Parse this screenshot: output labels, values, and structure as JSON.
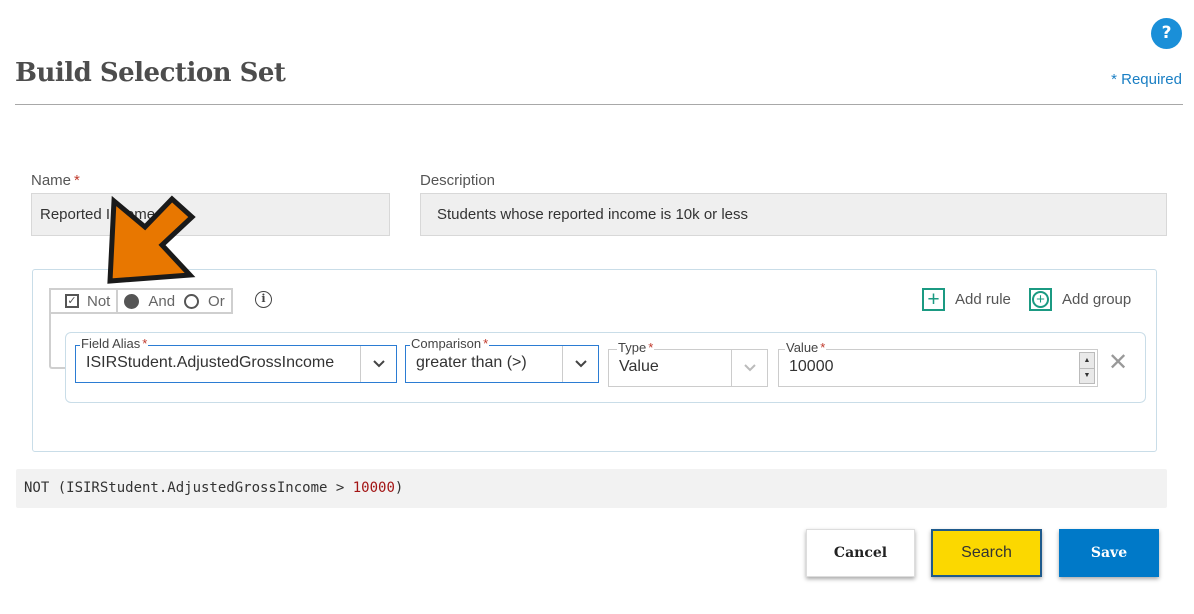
{
  "header": {
    "title": "Build Selection Set",
    "help_icon": "question-icon",
    "help_label": "?",
    "required_note": "* Required"
  },
  "form": {
    "name": {
      "label": "Name",
      "required_mark": "*",
      "value": "Reported Income"
    },
    "description": {
      "label": "Description",
      "value": "Students whose reported income is 10k or less"
    }
  },
  "query_builder": {
    "logic": {
      "not": {
        "label": "Not",
        "checked": true
      },
      "and": {
        "label": "And",
        "selected": true
      },
      "or": {
        "label": "Or",
        "selected": false
      },
      "info_icon": "info-icon"
    },
    "actions": {
      "add_rule": {
        "label": "Add rule",
        "icon": "plus-square-icon"
      },
      "add_group": {
        "label": "Add group",
        "icon": "plus-circle-icon"
      }
    },
    "rules": [
      {
        "field_alias": {
          "label": "Field Alias",
          "required_mark": "*",
          "value": "ISIRStudent.AdjustedGrossIncome"
        },
        "comparison": {
          "label": "Comparison",
          "required_mark": "*",
          "value": "greater than (>)"
        },
        "type": {
          "label": "Type",
          "required_mark": "*",
          "value": "Value"
        },
        "value": {
          "label": "Value",
          "required_mark": "*",
          "value": "10000"
        }
      }
    ]
  },
  "query_preview": {
    "prefix": "NOT (ISIRStudent.AdjustedGrossIncome > ",
    "number": "10000",
    "suffix": ")"
  },
  "buttons": {
    "cancel": "Cancel",
    "search": "Search",
    "save": "Save"
  },
  "colors": {
    "accent_blue": "#0079c8",
    "help_blue": "#1a8fd8",
    "search_yellow": "#fbd800",
    "add_green": "#1b9a82",
    "annotation_orange": "#e87700",
    "required_red": "#c0392b"
  }
}
